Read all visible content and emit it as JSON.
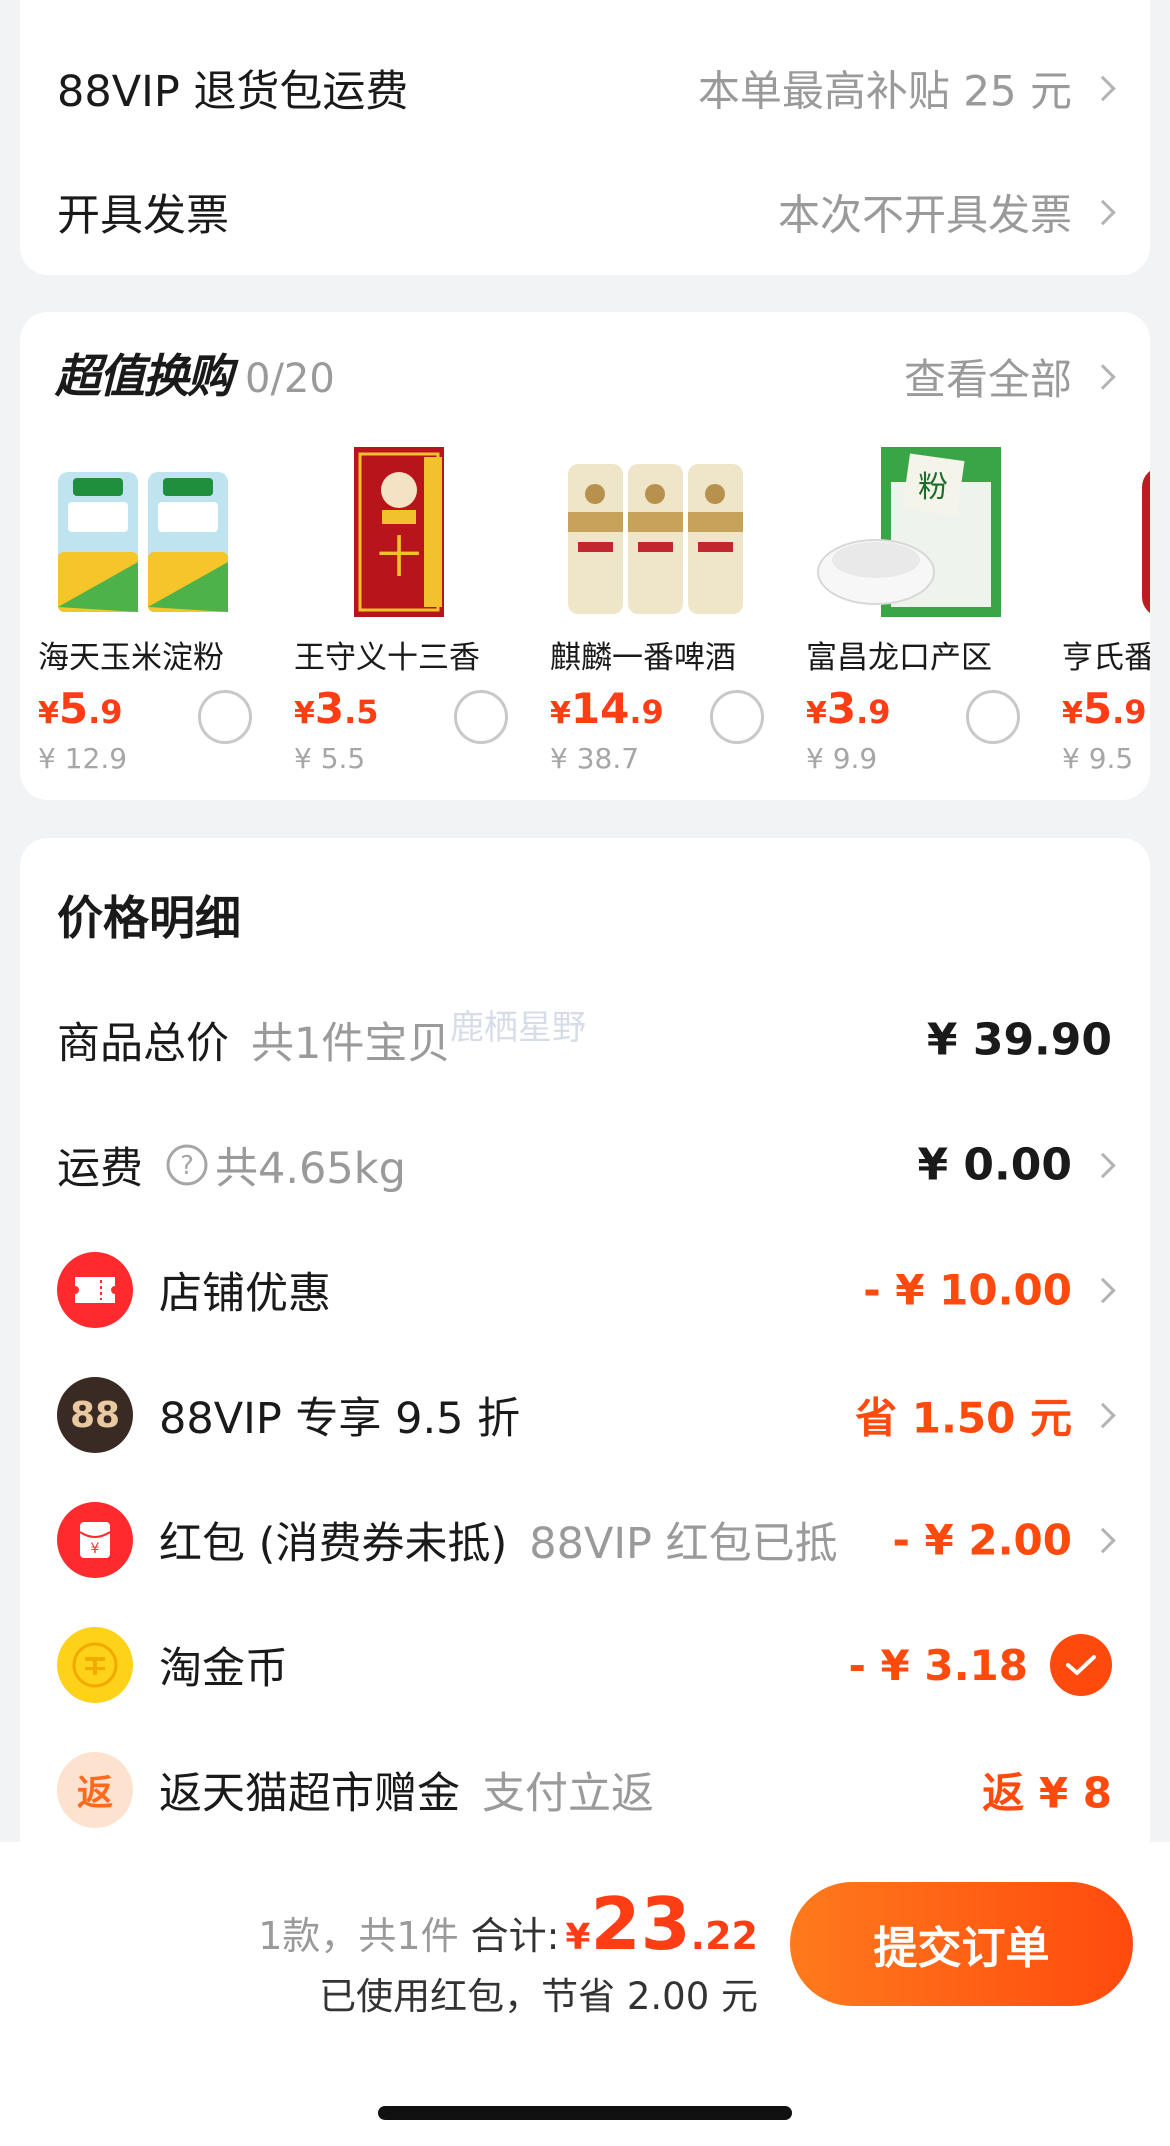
{
  "top": {
    "return_label": "88VIP 退货包运费",
    "return_value": "本单最高补贴 25 元",
    "invoice_label": "开具发票",
    "invoice_value": "本次不开具发票"
  },
  "swap": {
    "title": "超值换购",
    "count": "0/20",
    "view_all": "查看全部",
    "products": [
      {
        "name": "海天玉米淀粉",
        "yen": "¥",
        "price_int": "5",
        "price_dec": ".9",
        "orig": "¥ 12.9"
      },
      {
        "name": "王守义十三香",
        "yen": "¥",
        "price_int": "3",
        "price_dec": ".5",
        "orig": "¥ 5.5"
      },
      {
        "name": "麒麟一番啤酒",
        "yen": "¥",
        "price_int": "14",
        "price_dec": ".9",
        "orig": "¥ 38.7"
      },
      {
        "name": "富昌龙口产区",
        "yen": "¥",
        "price_int": "3",
        "price_dec": ".9",
        "orig": "¥ 9.9"
      },
      {
        "name": "亨氏番",
        "yen": "¥",
        "price_int": "5",
        "price_dec": ".9",
        "orig": "¥ 9.5"
      }
    ]
  },
  "price": {
    "title": "价格明细",
    "goods_label": "商品总价",
    "goods_sub": "共1件宝贝",
    "goods_value": "¥ 39.90",
    "shipping_label": "运费",
    "shipping_sub": "共4.65kg",
    "shipping_value": "¥ 0.00",
    "store_label": "店铺优惠",
    "store_value": "- ¥ 10.00",
    "vip_icon": "88",
    "vip_label": "88VIP 专享 9.5 折",
    "vip_value": "省 1.50 元",
    "redpack_label": "红包 (消费券未抵)",
    "redpack_sub": "88VIP 红包已抵",
    "redpack_value": "- ¥ 2.00",
    "coin_label": "淘金币",
    "coin_value": "- ¥ 3.18",
    "cashback_icon": "返",
    "cashback_label": "返天猫超市赠金",
    "cashback_sub": "支付立返",
    "cashback_value": "返 ¥ 8",
    "watermark": "鹿栖星野"
  },
  "bottom": {
    "count": "1款，共1件",
    "total_label": "合计:",
    "yen": "¥",
    "total_int": "23",
    "total_dec": ".22",
    "saved": "已使用红包，节省 2.00 元",
    "submit": "提交订单"
  },
  "colors": {
    "accent": "#ff4a0e",
    "background": "#f2f3f5",
    "muted": "#9a9a9a"
  }
}
